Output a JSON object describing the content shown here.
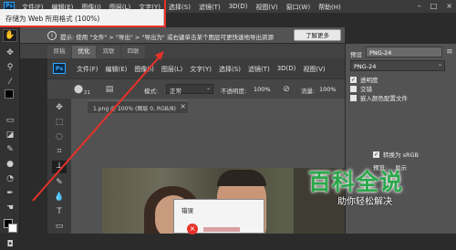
{
  "ps_main": {
    "app_logo": "Ps",
    "menu": [
      "文件(F)",
      "编辑(E)",
      "图像(I)",
      "图层(L)",
      "文字(Y)",
      "选择(S)",
      "滤镜(T)",
      "3D(D)",
      "视图(V)",
      "窗口(W)",
      "帮助(H)"
    ],
    "options_bar": {
      "size_value": "21",
      "mode_label": "模式:",
      "mode_value": "正常",
      "opacity_label": "不透明度:",
      "opacity_value": "100%",
      "flow_label": "流量:",
      "flow_value": "100%"
    },
    "doc_tab": "1.png @ 100% (图层 0, RGB/8)",
    "doc_tab_close": "×"
  },
  "right_panel": {
    "preset_label": "预设",
    "format_value": "PNG-24",
    "format_value2": "PNG-24",
    "checkboxes": [
      {
        "label": "透明度",
        "checked": true
      },
      {
        "label": "交错",
        "checked": false
      },
      {
        "label": "嵌入颜色配置文件",
        "checked": false
      }
    ],
    "convert_srgb": "转换为 sRGB",
    "preview_label": "预览:",
    "preview_value": "显示"
  },
  "dialog": {
    "title": "存储为 Web 所用格式 (100%)",
    "info_text": "提示: 使用 \"文件\" > \"导出\" > \"导出为\" 或右键单击某个图层可更快速地导出资源",
    "learn_more": "了解更多",
    "tabs": [
      "原稿",
      "优化",
      "双联",
      "四联"
    ]
  },
  "error_popup": {
    "title": "错误"
  },
  "watermark": {
    "title": "百科全说",
    "subtitle": "助你轻松解决"
  },
  "colors": {
    "accent_red": "#e8312a",
    "watermark_green": "#2aa84a"
  }
}
